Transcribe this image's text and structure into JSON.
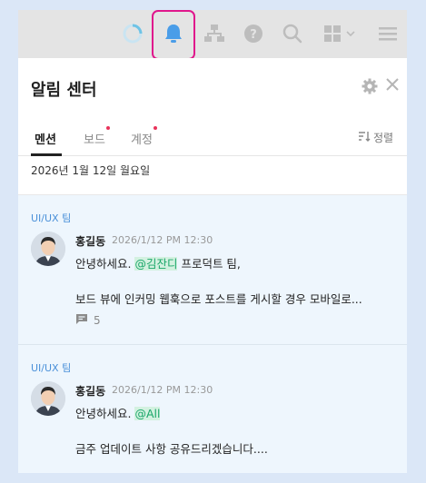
{
  "topbar": {
    "icons": [
      "loading-ring-icon",
      "bell-icon",
      "org-chart-icon",
      "help-icon",
      "search-icon",
      "grid-apps-icon",
      "menu-icon"
    ]
  },
  "panel": {
    "title": "알림 센터",
    "tabs": [
      {
        "label": "멘션",
        "active": true,
        "dot": false
      },
      {
        "label": "보드",
        "active": false,
        "dot": true
      },
      {
        "label": "계정",
        "active": false,
        "dot": true
      }
    ],
    "sort_label": "정렬",
    "date_header": "2026년 1월 12일 월요일"
  },
  "notifications": [
    {
      "team": "UI/UX 팀",
      "author": "홍길동",
      "time": "2026/1/12 PM 12:30",
      "greeting": "안녕하세요. ",
      "mention": "@김잔디",
      "after_mention": " 프로덕트 팀,",
      "body": "보드 뷰에 인커밍 웹훅으로 포스트를 게시할 경우 모바일로...",
      "reply_count": "5"
    },
    {
      "team": "UI/UX 팀",
      "author": "홍길동",
      "time": "2026/1/12 PM 12:30",
      "greeting": "안녕하세요. ",
      "mention": "@All",
      "after_mention": "",
      "body": "금주 업데이트 사항 공유드리겠습니다....",
      "reply_count": ""
    }
  ],
  "colors": {
    "accent_blue": "#4a90d9",
    "highlight_border": "#e0178c",
    "mention_green": "#1aa769",
    "notification_dot": "#e8325a"
  }
}
